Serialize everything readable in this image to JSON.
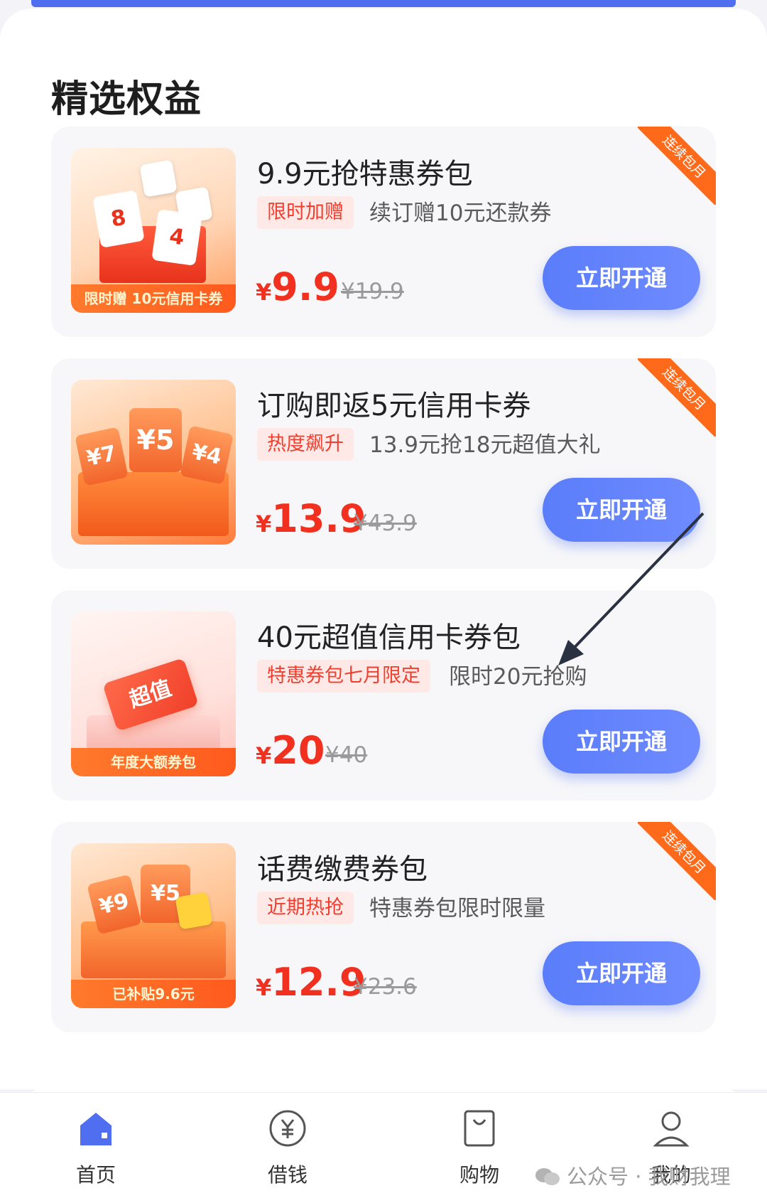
{
  "section_title": "精选权益",
  "cards": [
    {
      "title": "9.9元抢特惠券包",
      "tag": "限时加赠",
      "desc": "续订赠10元还款券",
      "yen": "¥",
      "price": "9.9",
      "old_price": "¥19.9",
      "cta": "立即开通",
      "ribbon": "连续包月",
      "thumb_label": "限时赠 10元信用卡券",
      "thumb_coupon_a": "8",
      "thumb_coupon_b": "4"
    },
    {
      "title": "订购即返5元信用卡券",
      "tag": "热度飙升",
      "desc": "13.9元抢18元超值大礼",
      "yen": "¥",
      "price": "13.9",
      "old_price": "¥43.9",
      "cta": "立即开通",
      "ribbon": "连续包月",
      "thumb_coupon_a": "¥7",
      "thumb_coupon_b": "¥5",
      "thumb_coupon_c": "¥4"
    },
    {
      "title": "40元超值信用卡券包",
      "tag": "特惠券包七月限定",
      "desc": "限时20元抢购",
      "yen": "¥",
      "price": "20",
      "old_price": "¥40",
      "cta": "立即开通",
      "thumb_label": "年度大额券包",
      "thumb_tag": "超值"
    },
    {
      "title": "话费缴费券包",
      "tag": "近期热抢",
      "desc": "特惠券包限时限量",
      "yen": "¥",
      "price": "12.9",
      "old_price": "¥23.6",
      "cta": "立即开通",
      "ribbon": "连续包月",
      "thumb_label": "已补贴9.6元",
      "thumb_coupon_a": "¥9",
      "thumb_coupon_b": "¥5"
    }
  ],
  "tabs": [
    {
      "label": "首页",
      "icon": "home-icon",
      "active": true
    },
    {
      "label": "借钱",
      "icon": "yen-coin-icon"
    },
    {
      "label": "购物",
      "icon": "shopping-bag-icon"
    },
    {
      "label": "我的",
      "icon": "user-icon"
    }
  ],
  "watermark": "公众号 · 我财我理",
  "colors": {
    "accent_blue": "#5a7dfa",
    "price_red": "#f2301f",
    "ribbon_orange": "#ff6a1a",
    "tag_bg": "#ffe9e6"
  }
}
